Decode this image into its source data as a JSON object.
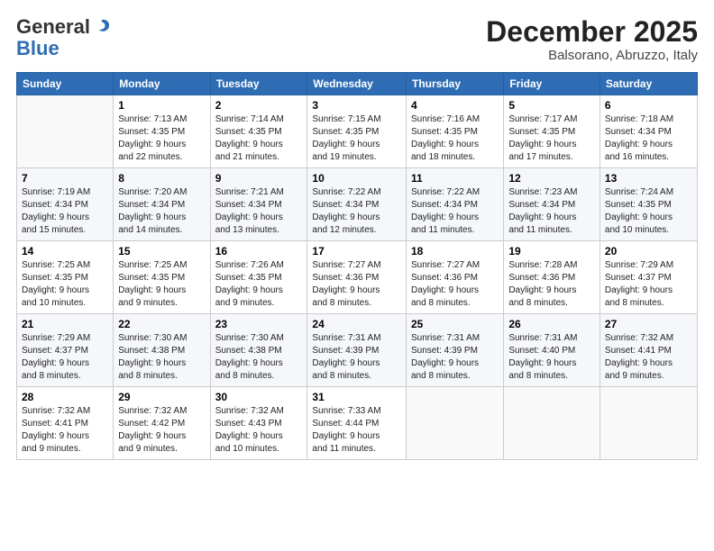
{
  "header": {
    "logo_general": "General",
    "logo_blue": "Blue",
    "month_title": "December 2025",
    "location": "Balsorano, Abruzzo, Italy"
  },
  "days_of_week": [
    "Sunday",
    "Monday",
    "Tuesday",
    "Wednesday",
    "Thursday",
    "Friday",
    "Saturday"
  ],
  "weeks": [
    [
      {
        "day": "",
        "info": ""
      },
      {
        "day": "1",
        "info": "Sunrise: 7:13 AM\nSunset: 4:35 PM\nDaylight: 9 hours\nand 22 minutes."
      },
      {
        "day": "2",
        "info": "Sunrise: 7:14 AM\nSunset: 4:35 PM\nDaylight: 9 hours\nand 21 minutes."
      },
      {
        "day": "3",
        "info": "Sunrise: 7:15 AM\nSunset: 4:35 PM\nDaylight: 9 hours\nand 19 minutes."
      },
      {
        "day": "4",
        "info": "Sunrise: 7:16 AM\nSunset: 4:35 PM\nDaylight: 9 hours\nand 18 minutes."
      },
      {
        "day": "5",
        "info": "Sunrise: 7:17 AM\nSunset: 4:35 PM\nDaylight: 9 hours\nand 17 minutes."
      },
      {
        "day": "6",
        "info": "Sunrise: 7:18 AM\nSunset: 4:34 PM\nDaylight: 9 hours\nand 16 minutes."
      }
    ],
    [
      {
        "day": "7",
        "info": "Sunrise: 7:19 AM\nSunset: 4:34 PM\nDaylight: 9 hours\nand 15 minutes."
      },
      {
        "day": "8",
        "info": "Sunrise: 7:20 AM\nSunset: 4:34 PM\nDaylight: 9 hours\nand 14 minutes."
      },
      {
        "day": "9",
        "info": "Sunrise: 7:21 AM\nSunset: 4:34 PM\nDaylight: 9 hours\nand 13 minutes."
      },
      {
        "day": "10",
        "info": "Sunrise: 7:22 AM\nSunset: 4:34 PM\nDaylight: 9 hours\nand 12 minutes."
      },
      {
        "day": "11",
        "info": "Sunrise: 7:22 AM\nSunset: 4:34 PM\nDaylight: 9 hours\nand 11 minutes."
      },
      {
        "day": "12",
        "info": "Sunrise: 7:23 AM\nSunset: 4:34 PM\nDaylight: 9 hours\nand 11 minutes."
      },
      {
        "day": "13",
        "info": "Sunrise: 7:24 AM\nSunset: 4:35 PM\nDaylight: 9 hours\nand 10 minutes."
      }
    ],
    [
      {
        "day": "14",
        "info": "Sunrise: 7:25 AM\nSunset: 4:35 PM\nDaylight: 9 hours\nand 10 minutes."
      },
      {
        "day": "15",
        "info": "Sunrise: 7:25 AM\nSunset: 4:35 PM\nDaylight: 9 hours\nand 9 minutes."
      },
      {
        "day": "16",
        "info": "Sunrise: 7:26 AM\nSunset: 4:35 PM\nDaylight: 9 hours\nand 9 minutes."
      },
      {
        "day": "17",
        "info": "Sunrise: 7:27 AM\nSunset: 4:36 PM\nDaylight: 9 hours\nand 8 minutes."
      },
      {
        "day": "18",
        "info": "Sunrise: 7:27 AM\nSunset: 4:36 PM\nDaylight: 9 hours\nand 8 minutes."
      },
      {
        "day": "19",
        "info": "Sunrise: 7:28 AM\nSunset: 4:36 PM\nDaylight: 9 hours\nand 8 minutes."
      },
      {
        "day": "20",
        "info": "Sunrise: 7:29 AM\nSunset: 4:37 PM\nDaylight: 9 hours\nand 8 minutes."
      }
    ],
    [
      {
        "day": "21",
        "info": "Sunrise: 7:29 AM\nSunset: 4:37 PM\nDaylight: 9 hours\nand 8 minutes."
      },
      {
        "day": "22",
        "info": "Sunrise: 7:30 AM\nSunset: 4:38 PM\nDaylight: 9 hours\nand 8 minutes."
      },
      {
        "day": "23",
        "info": "Sunrise: 7:30 AM\nSunset: 4:38 PM\nDaylight: 9 hours\nand 8 minutes."
      },
      {
        "day": "24",
        "info": "Sunrise: 7:31 AM\nSunset: 4:39 PM\nDaylight: 9 hours\nand 8 minutes."
      },
      {
        "day": "25",
        "info": "Sunrise: 7:31 AM\nSunset: 4:39 PM\nDaylight: 9 hours\nand 8 minutes."
      },
      {
        "day": "26",
        "info": "Sunrise: 7:31 AM\nSunset: 4:40 PM\nDaylight: 9 hours\nand 8 minutes."
      },
      {
        "day": "27",
        "info": "Sunrise: 7:32 AM\nSunset: 4:41 PM\nDaylight: 9 hours\nand 9 minutes."
      }
    ],
    [
      {
        "day": "28",
        "info": "Sunrise: 7:32 AM\nSunset: 4:41 PM\nDaylight: 9 hours\nand 9 minutes."
      },
      {
        "day": "29",
        "info": "Sunrise: 7:32 AM\nSunset: 4:42 PM\nDaylight: 9 hours\nand 9 minutes."
      },
      {
        "day": "30",
        "info": "Sunrise: 7:32 AM\nSunset: 4:43 PM\nDaylight: 9 hours\nand 10 minutes."
      },
      {
        "day": "31",
        "info": "Sunrise: 7:33 AM\nSunset: 4:44 PM\nDaylight: 9 hours\nand 11 minutes."
      },
      {
        "day": "",
        "info": ""
      },
      {
        "day": "",
        "info": ""
      },
      {
        "day": "",
        "info": ""
      }
    ]
  ]
}
